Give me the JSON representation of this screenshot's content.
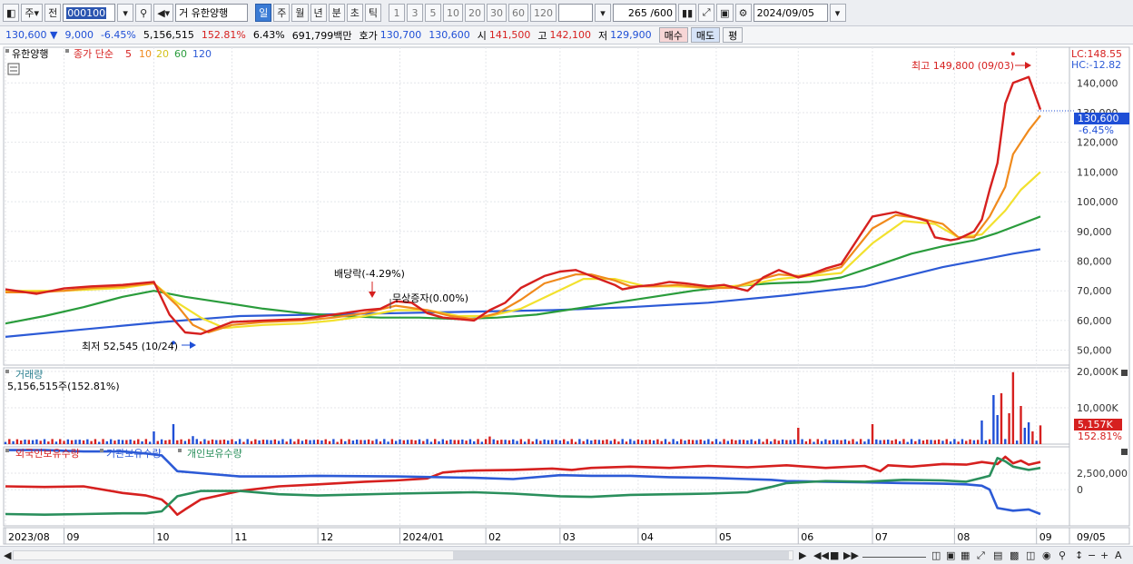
{
  "toolbar": {
    "period_type": "주",
    "prev_label": "전",
    "stock_code": "000100",
    "market_tag": "거",
    "stock_name": "유한양행",
    "intervals": [
      "일",
      "주",
      "월",
      "년",
      "분",
      "초",
      "틱"
    ],
    "active_interval": "일",
    "minute_steps": [
      "1",
      "3",
      "5",
      "10",
      "20",
      "30",
      "60",
      "120"
    ],
    "count_display": "265 /600",
    "date": "2024/09/05"
  },
  "infobar": {
    "price": "130,600 ▼",
    "change": "9,000",
    "change_pct": "-6.45%",
    "volume": "5,156,515",
    "volume_ratio": "152.81%",
    "turnover_pct": "6.43%",
    "trade_value": "691,799백만",
    "quote_label": "호가",
    "ask": "130,700",
    "bid": "130,600",
    "open_label": "시",
    "open": "141,500",
    "high_label": "고",
    "high": "142,100",
    "low_label": "저",
    "low": "129,900",
    "buy_label": "매수",
    "sell_label": "매도",
    "eval_label": "평"
  },
  "price_panel": {
    "stock_tab": "유한양행",
    "ma_label": "종가 단순",
    "lc_label": "LC:148.55",
    "hc_label": "HC:-12.82",
    "current_price_tag": "130,600",
    "current_pct_tag": "-6.45%",
    "annotation_high": "최고 149,800 (09/03)",
    "annotation_low": "최저 52,545 (10/24)",
    "annotation_dividend": "배당락(-4.29%)",
    "annotation_bonus": "무상증자(0.00%)"
  },
  "volume_panel": {
    "title": "거래량",
    "value_label": "5,156,515주(152.81%)",
    "current_tag": "5,157K",
    "current_pct": "152.81%"
  },
  "holdings_panel": {
    "series_labels": [
      "외국인보유수량",
      "기관보유수량",
      "개인보유수량"
    ]
  },
  "x_axis": {
    "labels": [
      "2023/08",
      "09",
      "10",
      "11",
      "12",
      "2024/01",
      "02",
      "03",
      "04",
      "05",
      "06",
      "07",
      "08",
      "09"
    ],
    "right_label": "09/05"
  },
  "colors": {
    "up": "#d6201f",
    "down": "#1f4fd6",
    "ma5": "#d6201f",
    "ma10": "#f08a1c",
    "ma20": "#f2e12e",
    "ma60": "#2a9c3c",
    "ma120": "#2c5ad6",
    "foreign": "#d6201f",
    "institution": "#2c5ad6",
    "individual": "#2a8f5c"
  },
  "chart_data": [
    {
      "type": "line",
      "name": "price",
      "ylim": [
        45000,
        152000
      ],
      "yticks": [
        "140,000",
        "130,000",
        "120,000",
        "110,000",
        "100,000",
        "90,000",
        "80,000",
        "70,000",
        "60,000",
        "50,000"
      ],
      "ytick_values": [
        140000,
        130000,
        120000,
        110000,
        100000,
        90000,
        80000,
        70000,
        60000,
        50000
      ],
      "xlim": [
        0,
        265
      ],
      "month_ticks": [
        0,
        15,
        38,
        58,
        80,
        101,
        123,
        142,
        162,
        182,
        203,
        222,
        243,
        264
      ],
      "high": {
        "x": 258,
        "value": 149800
      },
      "low": {
        "x": 43,
        "value": 52545
      },
      "last_close": 130600,
      "ma_periods": [
        "5",
        "10",
        "20",
        "60",
        "120"
      ],
      "series": [
        {
          "name": "5",
          "x": [
            0,
            8,
            15,
            22,
            30,
            38,
            42,
            46,
            50,
            58,
            66,
            76,
            84,
            92,
            96,
            100,
            104,
            108,
            112,
            120,
            124,
            128,
            132,
            138,
            142,
            146,
            150,
            156,
            158,
            162,
            166,
            170,
            174,
            180,
            184,
            190,
            194,
            198,
            203,
            206,
            210,
            214,
            222,
            228,
            232,
            236,
            238,
            242,
            244,
            248,
            250,
            252,
            254,
            256,
            258,
            262,
            265
          ],
          "values": [
            70500,
            69000,
            70800,
            71500,
            72000,
            73000,
            62000,
            56000,
            55500,
            59500,
            60000,
            60500,
            62000,
            63500,
            64000,
            66500,
            66000,
            62500,
            61000,
            60000,
            63500,
            66000,
            71000,
            75000,
            76500,
            77000,
            75000,
            72000,
            70500,
            71500,
            72000,
            73000,
            72500,
            71500,
            72000,
            70000,
            74500,
            77000,
            74500,
            75500,
            77500,
            79000,
            95000,
            96500,
            95000,
            93500,
            88000,
            87000,
            87500,
            90000,
            94000,
            104000,
            113000,
            133000,
            140000,
            142000,
            131000
          ]
        },
        {
          "name": "10",
          "x": [
            0,
            8,
            15,
            22,
            30,
            38,
            44,
            48,
            52,
            58,
            66,
            76,
            84,
            92,
            100,
            108,
            114,
            120,
            126,
            132,
            138,
            146,
            150,
            156,
            160,
            166,
            172,
            180,
            186,
            192,
            198,
            203,
            208,
            214,
            222,
            228,
            234,
            240,
            244,
            248,
            252,
            256,
            258,
            262,
            265
          ],
          "values": [
            69500,
            69500,
            70000,
            71000,
            71500,
            72500,
            65000,
            58500,
            56000,
            58500,
            59500,
            60000,
            61000,
            62500,
            65000,
            63500,
            61500,
            60500,
            62500,
            67000,
            72500,
            75500,
            75500,
            73500,
            71500,
            71500,
            72000,
            71000,
            71000,
            73500,
            75500,
            75000,
            76000,
            78000,
            91000,
            95500,
            94500,
            92500,
            88000,
            88000,
            95000,
            105000,
            116000,
            124000,
            129000
          ]
        },
        {
          "name": "20",
          "x": [
            0,
            15,
            30,
            38,
            44,
            50,
            56,
            66,
            76,
            84,
            92,
            100,
            108,
            116,
            124,
            132,
            140,
            148,
            156,
            164,
            172,
            180,
            190,
            198,
            206,
            214,
            222,
            230,
            238,
            244,
            250,
            256,
            260,
            265
          ],
          "values": [
            70000,
            70000,
            71000,
            72500,
            66000,
            61000,
            57500,
            58500,
            59000,
            60000,
            61500,
            63500,
            63500,
            61500,
            61500,
            64000,
            69000,
            74000,
            74000,
            71500,
            71500,
            71000,
            72000,
            74000,
            75000,
            76000,
            86000,
            93500,
            92500,
            88000,
            89000,
            97000,
            104000,
            110000
          ]
        },
        {
          "name": "60",
          "x": [
            0,
            10,
            20,
            30,
            38,
            46,
            56,
            66,
            76,
            86,
            96,
            106,
            116,
            126,
            136,
            146,
            156,
            166,
            176,
            186,
            196,
            206,
            214,
            222,
            232,
            240,
            248,
            254,
            260,
            265
          ],
          "values": [
            59000,
            61500,
            64500,
            68000,
            70000,
            68000,
            66000,
            64000,
            62500,
            61500,
            61000,
            61000,
            60500,
            61000,
            62000,
            64000,
            66000,
            68000,
            70000,
            71500,
            72500,
            73000,
            74500,
            78000,
            82500,
            85000,
            87000,
            89500,
            92500,
            95000
          ]
        },
        {
          "name": "120",
          "x": [
            0,
            20,
            40,
            60,
            80,
            100,
            120,
            140,
            160,
            180,
            200,
            220,
            240,
            250,
            258,
            265
          ],
          "values": [
            54500,
            57000,
            59500,
            61500,
            62000,
            62500,
            63000,
            63500,
            64500,
            66000,
            68500,
            71500,
            78000,
            80500,
            82500,
            84000
          ]
        }
      ]
    },
    {
      "type": "bar",
      "name": "volume",
      "ylim": [
        0,
        21000
      ],
      "yticks": [
        "20,000K",
        "10,000K"
      ],
      "ytick_values": [
        20000,
        10000
      ],
      "units": "K shares",
      "spikes": [
        {
          "x": 38,
          "value": 3500
        },
        {
          "x": 43,
          "value": 5500
        },
        {
          "x": 48,
          "value": 2200
        },
        {
          "x": 124,
          "value": 2100
        },
        {
          "x": 203,
          "value": 4500
        },
        {
          "x": 222,
          "value": 5500
        },
        {
          "x": 250,
          "value": 6500
        },
        {
          "x": 253,
          "value": 13500
        },
        {
          "x": 254,
          "value": 8000
        },
        {
          "x": 255,
          "value": 14000
        },
        {
          "x": 257,
          "value": 8500
        },
        {
          "x": 258,
          "value": 19800
        },
        {
          "x": 260,
          "value": 10500
        },
        {
          "x": 261,
          "value": 4500
        },
        {
          "x": 262,
          "value": 6000
        },
        {
          "x": 263,
          "value": 3500
        },
        {
          "x": 265,
          "value": 5157
        }
      ],
      "baseline": 1000
    },
    {
      "type": "line",
      "name": "holdings",
      "ylim": [
        -5500000,
        6500000
      ],
      "yticks": [
        "2,500,000",
        "0"
      ],
      "ytick_values": [
        2500000,
        0
      ],
      "series": [
        {
          "name": "외국인보유수량",
          "x": [
            0,
            10,
            20,
            30,
            36,
            40,
            42,
            44,
            46,
            50,
            60,
            70,
            80,
            92,
            100,
            108,
            112,
            116,
            120,
            130,
            140,
            145,
            150,
            160,
            170,
            180,
            190,
            200,
            210,
            220,
            224,
            226,
            232,
            240,
            246,
            250,
            254,
            256,
            258,
            260,
            262,
            265
          ],
          "values": [
            500000,
            400000,
            500000,
            -500000,
            -900000,
            -1500000,
            -2500000,
            -3800000,
            -3000000,
            -1500000,
            -200000,
            500000,
            800000,
            1200000,
            1400000,
            1700000,
            2600000,
            2800000,
            2900000,
            3000000,
            3200000,
            3000000,
            3300000,
            3500000,
            3300000,
            3600000,
            3400000,
            3700000,
            3300000,
            3600000,
            2800000,
            3700000,
            3500000,
            3900000,
            3800000,
            4200000,
            3900000,
            5000000,
            4000000,
            4400000,
            3800000,
            4200000
          ]
        },
        {
          "name": "기관보유수량",
          "x": [
            0,
            10,
            20,
            30,
            36,
            40,
            44,
            50,
            60,
            70,
            80,
            100,
            120,
            130,
            142,
            150,
            160,
            170,
            180,
            190,
            196,
            200,
            210,
            220,
            230,
            240,
            246,
            250,
            252,
            254,
            258,
            262,
            265
          ],
          "values": [
            6000000,
            6000000,
            5800000,
            5800000,
            5500000,
            5200000,
            2800000,
            2500000,
            2000000,
            2000000,
            2100000,
            2000000,
            1800000,
            1600000,
            2200000,
            2100000,
            2100000,
            1900000,
            1800000,
            1600000,
            1500000,
            1300000,
            1200000,
            1100000,
            1000000,
            900000,
            800000,
            600000,
            0,
            -2800000,
            -3200000,
            -3000000,
            -3700000
          ]
        },
        {
          "name": "개인보유수량",
          "x": [
            0,
            10,
            20,
            30,
            36,
            40,
            44,
            50,
            60,
            70,
            80,
            100,
            120,
            130,
            142,
            150,
            160,
            170,
            180,
            190,
            196,
            200,
            210,
            220,
            230,
            240,
            246,
            250,
            252,
            254,
            256,
            258,
            262,
            265
          ],
          "values": [
            -3700000,
            -3800000,
            -3700000,
            -3600000,
            -3600000,
            -3300000,
            -1000000,
            -200000,
            -200000,
            -700000,
            -900000,
            -600000,
            -400000,
            -600000,
            -1000000,
            -1100000,
            -800000,
            -700000,
            -600000,
            -400000,
            400000,
            1000000,
            1300000,
            1200000,
            1500000,
            1400000,
            1200000,
            1800000,
            2100000,
            4800000,
            4300000,
            3500000,
            3000000,
            3300000
          ]
        }
      ]
    }
  ]
}
